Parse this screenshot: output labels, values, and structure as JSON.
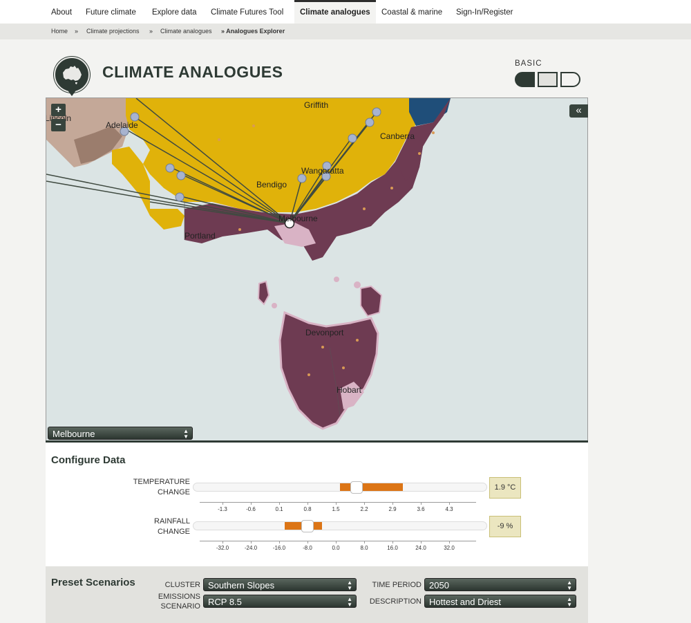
{
  "nav": {
    "items": [
      "About",
      "Future climate",
      "Explore data",
      "Climate Futures Tool",
      "Climate analogues",
      "Coastal & marine",
      "Sign-In/Register"
    ],
    "active": "Climate analogues"
  },
  "breadcrumb": {
    "items": [
      "Home",
      "Climate projections",
      "Climate analogues"
    ],
    "separator": "»",
    "current": "» Analogues Explorer"
  },
  "header": {
    "title": "CLIMATE ANALOGUES",
    "mode_label": "BASIC",
    "mode_options": [
      "basic",
      "intermediate",
      "advanced"
    ],
    "selected_mode": "basic"
  },
  "map": {
    "zoom_in": "+",
    "zoom_out": "−",
    "collapse": "«",
    "place_labels": [
      "Griffith",
      "Adelaide",
      "Canberra",
      "Wangaratta",
      "Bendigo",
      "Melbourne",
      "Portland",
      "Devonport",
      "Hobart",
      "Lincoln"
    ],
    "location_select": "Melbourne",
    "colors": {
      "sea": "#dbe4e4",
      "analogue_region": "#e0b20a",
      "cluster_region": "#6e3b52",
      "light_region": "#d9b3c5",
      "land_other": "#c4a898",
      "marker": "#a7b3cf"
    }
  },
  "configure": {
    "title": "Configure Data",
    "temperature": {
      "label_line1": "TEMPERATURE",
      "label_line2": "CHANGE",
      "value": "1.9 °C",
      "ticks": [
        "-1.3",
        "-0.6",
        "0.1",
        "0.8",
        "1.5",
        "2.2",
        "2.9",
        "3.6",
        "4.3"
      ],
      "handle_value": 1.9,
      "range": [
        1.5,
        3.0
      ]
    },
    "rainfall": {
      "label_line1": "RAINFALL",
      "label_line2": "CHANGE",
      "value": "-9 %",
      "ticks": [
        "-32.0",
        "-24.0",
        "-16.0",
        "-8.0",
        "0.0",
        "8.0",
        "16.0",
        "24.0",
        "32.0"
      ],
      "handle_value": -9,
      "range": [
        -16,
        -2
      ]
    },
    "accent_color": "#dc7516"
  },
  "presets": {
    "title": "Preset Scenarios",
    "cluster_label": "CLUSTER",
    "cluster_value": "Southern Slopes",
    "emissions_label_line1": "EMISSIONS",
    "emissions_label_line2": "SCENARIO",
    "emissions_value": "RCP 8.5",
    "time_label": "TIME PERIOD",
    "time_value": "2050",
    "description_label": "DESCRIPTION",
    "description_value": "Hottest and Driest"
  }
}
